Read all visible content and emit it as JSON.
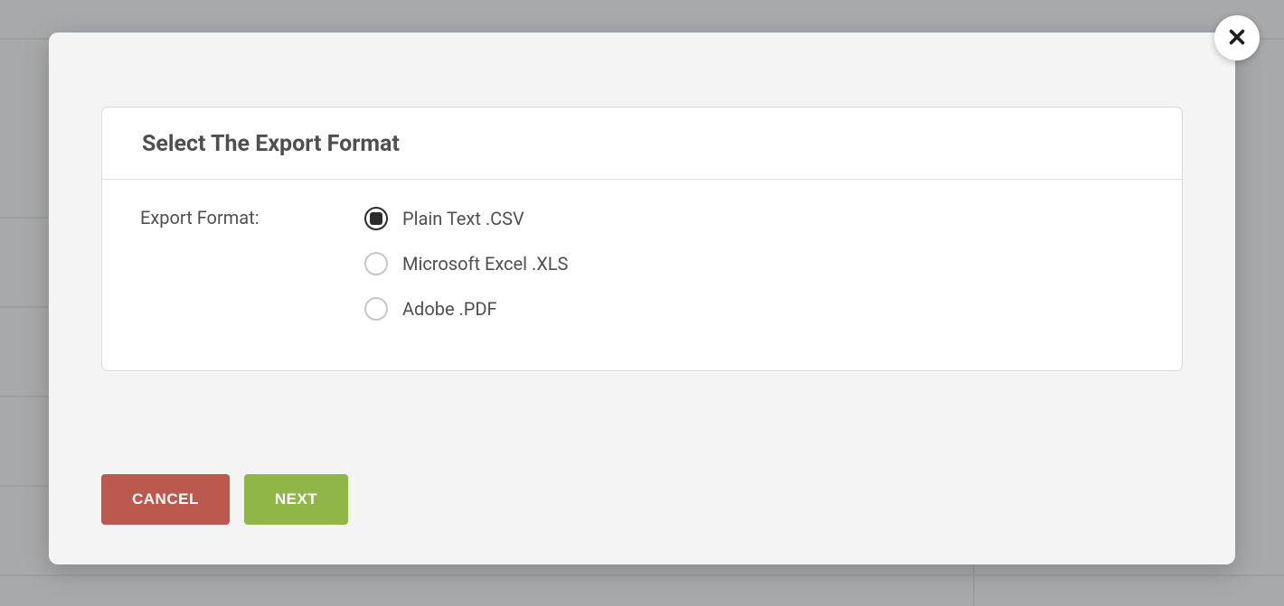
{
  "modal": {
    "panel_title": "Select The Export Format",
    "field_label": "Export Format:",
    "options": [
      {
        "label": "Plain Text .CSV",
        "selected": true
      },
      {
        "label": "Microsoft Excel .XLS",
        "selected": false
      },
      {
        "label": "Adobe .PDF",
        "selected": false
      }
    ],
    "cancel_label": "CANCEL",
    "next_label": "NEXT"
  }
}
